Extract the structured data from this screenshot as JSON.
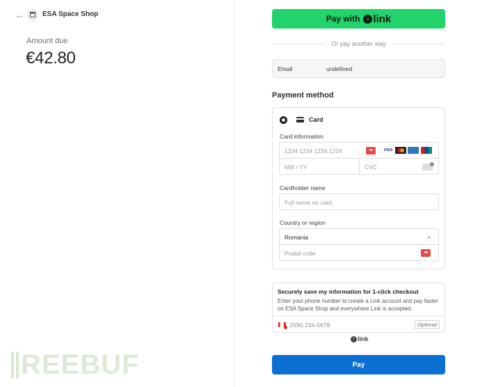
{
  "header": {
    "store_name": "ESA Space Shop"
  },
  "summary": {
    "amount_label": "Amount due",
    "amount": "€42.80"
  },
  "watermark": {
    "text": "REEBUF"
  },
  "express": {
    "link_pay_prefix": "Pay with",
    "link_word": "link",
    "link_color": "#22d36b",
    "divider_text": "Or pay another way"
  },
  "email": {
    "label": "Email",
    "value": "undefined"
  },
  "payment": {
    "section_title": "Payment method",
    "method_label": "Card",
    "card_info_label": "Card information",
    "card_number_placeholder": "1234 1234 1234 1234",
    "expiry_placeholder": "MM / YY",
    "cvc_placeholder": "CVC",
    "brands": [
      "VISA",
      "Mastercard",
      "Amex",
      "UnionPay"
    ],
    "cardholder_label": "Cardholder name",
    "cardholder_placeholder": "Full name on card",
    "country_label": "Country or region",
    "country_value": "Romania",
    "postal_placeholder": "Postal code"
  },
  "save_info": {
    "title": "Securely save my information for 1-click checkout",
    "description": "Enter your phone number to create a Link account and pay faster on ESA Space Shop and everywhere Link is accepted.",
    "phone_placeholder": "(506) 234-5678",
    "optional_label": "Optional",
    "link_footer": "link"
  },
  "pay_button": {
    "label": "Pay",
    "color": "#0b6fd4"
  }
}
